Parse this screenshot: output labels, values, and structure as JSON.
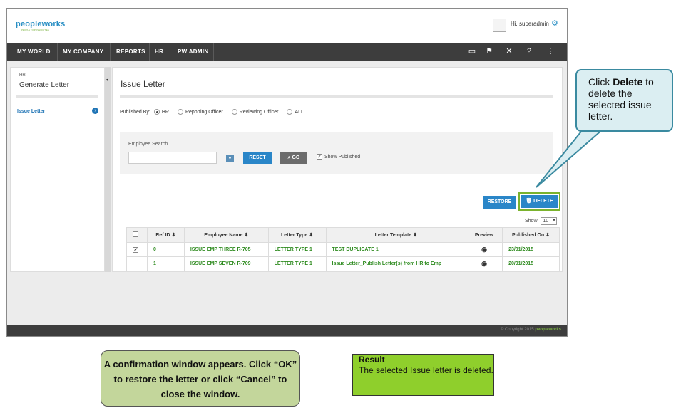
{
  "header": {
    "logo_main": "peopleworks",
    "logo_tagline": "PEOPLE TO POSSIBILITIES",
    "greeting": "Hi, superadmin"
  },
  "nav": {
    "items": [
      "MY WORLD",
      "MY COMPANY",
      "REPORTS",
      "HR",
      "PW ADMIN"
    ],
    "icons": [
      "book-icon",
      "flag-icon",
      "tools-icon",
      "help-icon",
      "sitemap-icon"
    ]
  },
  "sidebar": {
    "module": "HR",
    "title": "Generate Letter",
    "items": [
      {
        "label": "Issue Letter"
      }
    ]
  },
  "main": {
    "title": "Issue Letter",
    "published_by_label": "Published By:",
    "published_by_options": [
      "HR",
      "Reporting Officer",
      "Reviewing Officer",
      "ALL"
    ],
    "published_by_selected": "HR",
    "employee_search_label": "Employee Search",
    "employee_search_value": "",
    "reset_label": "RESET",
    "go_label": "GO",
    "show_published_label": "Show Published",
    "restore_label": "RESTORE",
    "delete_label": "DELETE",
    "show_label": "Show:",
    "show_value": "10",
    "table": {
      "columns": [
        "",
        "Ref ID",
        "Employee Name",
        "Letter Type",
        "Letter Template",
        "Preview",
        "Published On"
      ],
      "rows": [
        {
          "checked": true,
          "ref_id": "0",
          "employee_name": "ISSUE EMP THREE R-705",
          "letter_type": "LETTER TYPE 1",
          "letter_template": "TEST DUPLICATE 1",
          "published_on": "23/01/2015"
        },
        {
          "checked": false,
          "ref_id": "1",
          "employee_name": "ISSUE EMP SEVEN R-709",
          "letter_type": "LETTER TYPE 1",
          "letter_template": "Issue Letter_Publish Letter(s) from HR to Emp",
          "published_on": "20/01/2015"
        }
      ]
    }
  },
  "footer": {
    "copyright": "© Copyright 2015",
    "brand": "peopleworks"
  },
  "callout": {
    "pre": "Click ",
    "bold": "Delete",
    "post": " to delete the selected issue letter."
  },
  "note": {
    "text": "A confirmation window appears. Click “OK” to restore the letter or click “Cancel” to close the window."
  },
  "result": {
    "heading": "Result",
    "body": "The selected Issue letter is deleted."
  },
  "colors": {
    "nav_bg": "#3d3d3d",
    "accent_blue": "#2a86c8",
    "row_green": "#2e8b1f",
    "result_green": "#8fcf2c",
    "note_green": "#c3d69b",
    "bubble_bg": "#dbeef2"
  }
}
